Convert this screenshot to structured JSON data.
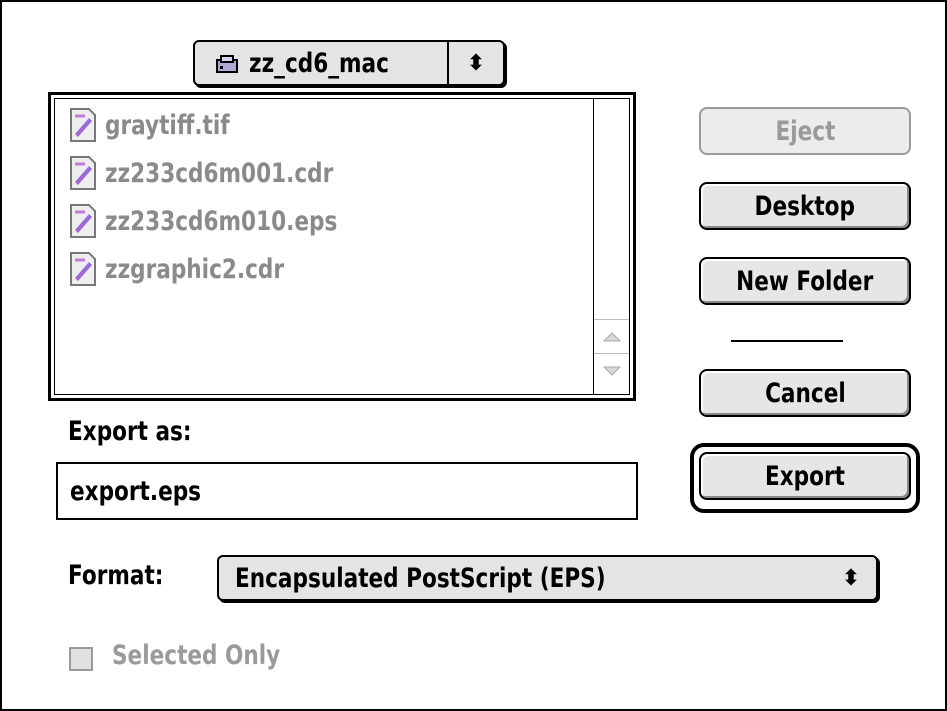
{
  "volume_popup": {
    "label": "zz_cd6_mac",
    "icon": "disk-icon",
    "arrow": "⬍"
  },
  "file_list": {
    "items": [
      {
        "name": "graytiff.tif",
        "icon": "document-icon"
      },
      {
        "name": "zz233cd6m001.cdr",
        "icon": "document-icon"
      },
      {
        "name": "zz233cd6m010.eps",
        "icon": "document-icon"
      },
      {
        "name": "zzgraphic2.cdr",
        "icon": "document-icon"
      }
    ],
    "scroll_up": "▲",
    "scroll_down": "▼"
  },
  "buttons": {
    "eject": "Eject",
    "desktop": "Desktop",
    "new_folder": "New Folder",
    "cancel": "Cancel",
    "export": "Export"
  },
  "export_as": {
    "label": "Export as:",
    "value": "export.eps"
  },
  "format": {
    "label": "Format:",
    "value": "Encapsulated PostScript (EPS)",
    "arrow": "⬍"
  },
  "selected_only": {
    "label": "Selected Only",
    "checked": false
  }
}
